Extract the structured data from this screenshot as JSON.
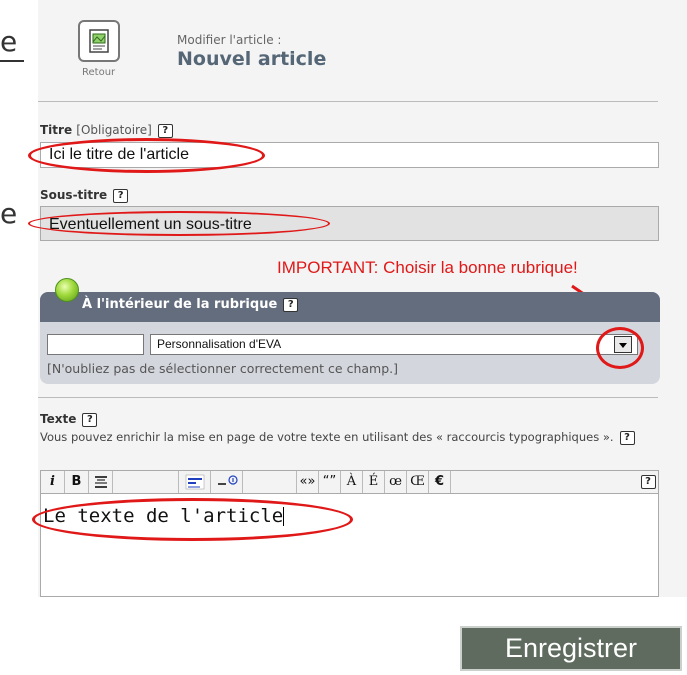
{
  "header": {
    "back_label": "Retour",
    "modify_label": "Modifier l'article :",
    "article_name": "Nouvel article"
  },
  "titre": {
    "label": "Titre",
    "required": "[Obligatoire]",
    "value": "Ici le titre de l'article"
  },
  "sous_titre": {
    "label": "Sous-titre",
    "value": "Eventuellement un sous-titre"
  },
  "annotation": {
    "important": "IMPORTANT: Choisir la bonne rubrique!",
    "color": "#e01818"
  },
  "rubrique": {
    "heading": "À l'intérieur de la rubrique",
    "selected": "Personnalisation d'EVA",
    "hint": "[N'oubliez pas de sélectionner correctement ce champ.]",
    "header_color": "#636d7e"
  },
  "texte": {
    "label": "Texte",
    "description": "Vous pouvez enrichir la mise en page de votre texte en utilisant des « raccourcis typographiques ».",
    "value": "Le texte de l'article"
  },
  "toolbar": {
    "italic": "i",
    "bold": "B",
    "quotes_fr": "«»",
    "quotes_en": "“”",
    "a_grave": "À",
    "e_acute": "É",
    "oe": "œ",
    "oe_cap": "Œ",
    "euro": "€",
    "help": "?"
  },
  "help_glyph": "?",
  "edge_mark": "e",
  "save_label": "Enregistrer"
}
